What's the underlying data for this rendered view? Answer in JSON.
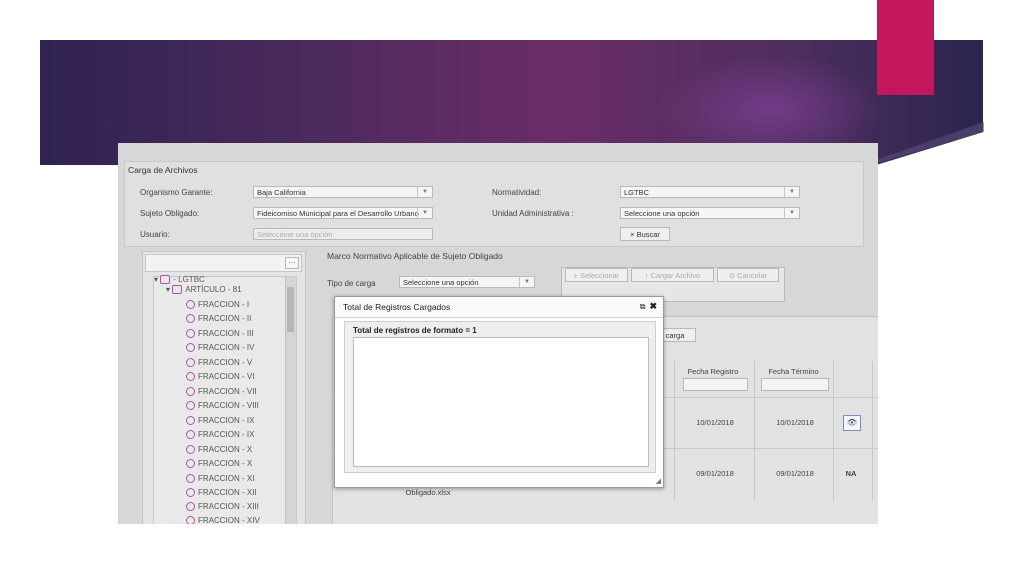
{
  "form": {
    "section_title": "Carga de Archivos",
    "organismo_label": "Organismo Garante:",
    "organismo_value": "Baja California",
    "normatividad_label": "Normatividad:",
    "normatividad_value": "LGTBC",
    "sujeto_label": "Sujeto Obligado:",
    "sujeto_value": "Fideicomiso Municipal para el Desarrollo Urbano",
    "unidad_label": "Unidad Administrativa :",
    "unidad_value": "Seleccione una opción",
    "usuario_label": "Usuario:",
    "usuario_value": "Seleccione una opción",
    "buscar_label": "Buscar",
    "marco_title": "Marco Normativo Aplicable de Sujeto Obligado",
    "tipo_label": "Tipo de carga",
    "tipo_value": "Seleccione una opción",
    "seleccionar_label": "Seleccionar",
    "cargar_label": "Cargar Archivo",
    "cancelar_label": "Cancelar",
    "descarga_label": "carga"
  },
  "tree": {
    "root": "- LGTBC",
    "article": "ARTÍCULO - 81",
    "fractions": [
      "FRACCION - I",
      "FRACCION - II",
      "FRACCION - III",
      "FRACCION - IV",
      "FRACCION - V",
      "FRACCION - VI",
      "FRACCION - VII",
      "FRACCION - VIII",
      "FRACCION - IX",
      "FRACCION - IX",
      "FRACCION - X",
      "FRACCION - X",
      "FRACCION - XI",
      "FRACCION - XII",
      "FRACCION - XIII",
      "FRACCION - XIV"
    ]
  },
  "table": {
    "headers": {
      "fecha_registro": "Fecha Registro",
      "fecha_termino": "Fecha Término"
    },
    "rows": [
      {
        "fecha_registro": "10/01/2018",
        "fecha_termino": "10/01/2018",
        "action": "eye"
      },
      {
        "fecha_registro": "09/01/2018",
        "fecha_termino": "09/01/2018",
        "action": "NA"
      }
    ],
    "file_fragment": "Obligado.xlsx"
  },
  "modal": {
    "title": "Total de Registros Cargados",
    "label": "Total de registros de formato = 1"
  },
  "colors": {
    "accent": "#c2185b",
    "banner": "#5a2a62"
  }
}
